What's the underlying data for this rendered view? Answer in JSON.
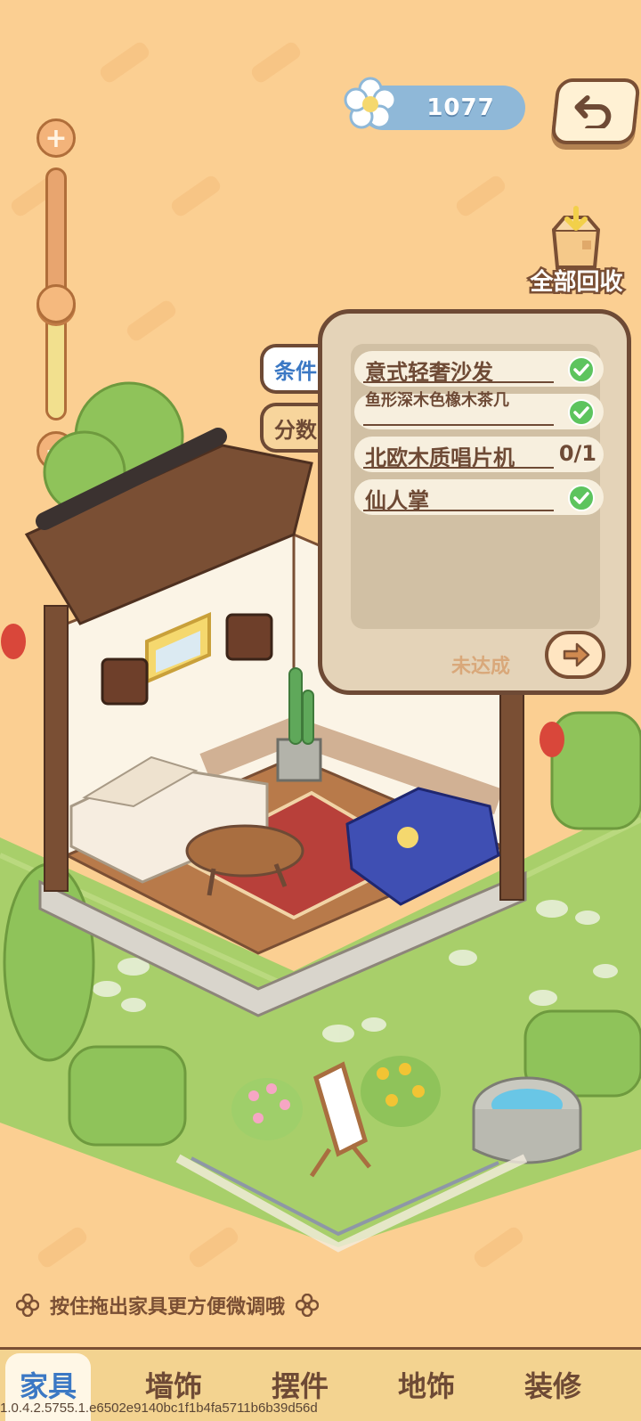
{
  "currency": {
    "amount": "1077",
    "icon": "flower-icon"
  },
  "zoom": {
    "plus_label": "+",
    "minus_label": "−",
    "level": 0.45
  },
  "recycle": {
    "label": "全部回收",
    "icon": "box-icon"
  },
  "tabs": {
    "conditions": "条件",
    "score": "分数"
  },
  "conditions": [
    {
      "name": "意式轻奢沙发",
      "done": true
    },
    {
      "name": "鱼形深木色橡木茶几",
      "done": true
    },
    {
      "name": "北欧木质唱片机",
      "done": false,
      "progress": "0/1"
    },
    {
      "name": "仙人掌",
      "done": true
    }
  ],
  "status_text": "未达成",
  "hint": "按住拖出家具更方便微调哦",
  "nav": [
    "家具",
    "墙饰",
    "摆件",
    "地饰",
    "装修"
  ],
  "nav_active_index": 0,
  "version": "1.0.4.2.5755.1.e6502e9140bc1f1b4fa5711b6b39d56d",
  "colors": {
    "background": "#fbcf92",
    "accent_blue": "#3b78c4",
    "brown": "#6e4a35",
    "check_green": "#5dc45e"
  }
}
